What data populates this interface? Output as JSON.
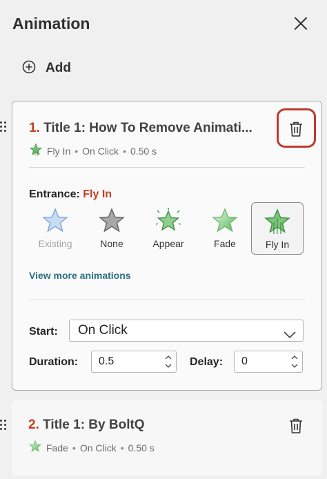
{
  "panel": {
    "title": "Animation",
    "close_icon": "close-icon",
    "add_label": "Add"
  },
  "animations": [
    {
      "number": "1.",
      "title": "Title 1: How To Remove Animati...",
      "effect": "Fly In",
      "trigger": "On Click",
      "duration": "0.50 s"
    },
    {
      "number": "2.",
      "title": "Title 1: By BoltQ",
      "effect": "Fade",
      "trigger": "On Click",
      "duration": "0.50 s"
    }
  ],
  "details": {
    "entrance_label": "Entrance:",
    "entrance_value": "Fly In",
    "effects": [
      {
        "label": "Existing",
        "icon": "star-existing-icon",
        "state": "disabled"
      },
      {
        "label": "None",
        "icon": "star-none-icon",
        "state": "normal"
      },
      {
        "label": "Appear",
        "icon": "star-appear-icon",
        "state": "normal"
      },
      {
        "label": "Fade",
        "icon": "star-fade-icon",
        "state": "normal"
      },
      {
        "label": "Fly In",
        "icon": "star-flyin-icon",
        "state": "selected"
      }
    ],
    "more_link": "View more animations",
    "start_label": "Start:",
    "start_value": "On Click",
    "duration_label": "Duration:",
    "duration_value": "0.5",
    "delay_label": "Delay:",
    "delay_value": "0"
  },
  "colors": {
    "accent_red": "#c43e1c",
    "highlight_outline": "#c0392b",
    "link": "#2b6f87",
    "star_green": "#5cb85c"
  }
}
